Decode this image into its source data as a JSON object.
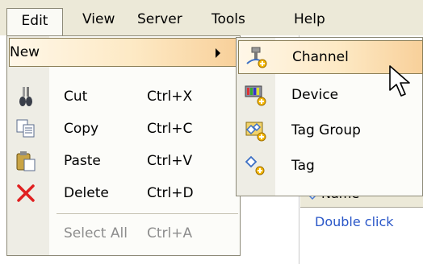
{
  "menubar": {
    "items": [
      "Edit",
      "View",
      "Server",
      "Tools",
      "Help"
    ],
    "active": "Edit"
  },
  "edit_menu": {
    "items": [
      {
        "label": "New",
        "shortcut": "",
        "icon": "new-icon",
        "submenu": true,
        "highlighted": true
      },
      {
        "label": "Cut",
        "shortcut": "Ctrl+X",
        "icon": "scissors-icon"
      },
      {
        "label": "Copy",
        "shortcut": "Ctrl+C",
        "icon": "copy-icon"
      },
      {
        "label": "Paste",
        "shortcut": "Ctrl+V",
        "icon": "paste-icon"
      },
      {
        "label": "Delete",
        "shortcut": "Ctrl+D",
        "icon": "delete-x-icon"
      },
      {
        "label": "Select All",
        "shortcut": "Ctrl+A",
        "disabled": true
      }
    ]
  },
  "new_submenu": {
    "items": [
      {
        "label": "Channel",
        "icon": "channel-icon",
        "highlighted": true
      },
      {
        "label": "Device",
        "icon": "device-icon"
      },
      {
        "label": "Tag Group",
        "icon": "tag-group-icon"
      },
      {
        "label": "Tag",
        "icon": "tag-icon"
      }
    ]
  },
  "background": {
    "column_header": "Name",
    "hint_text": "Double click"
  },
  "colors": {
    "menu_bg": "#ece9d8",
    "highlight": "#f8d09a",
    "link_blue": "#2a57c8",
    "delete_red": "#e02020"
  }
}
